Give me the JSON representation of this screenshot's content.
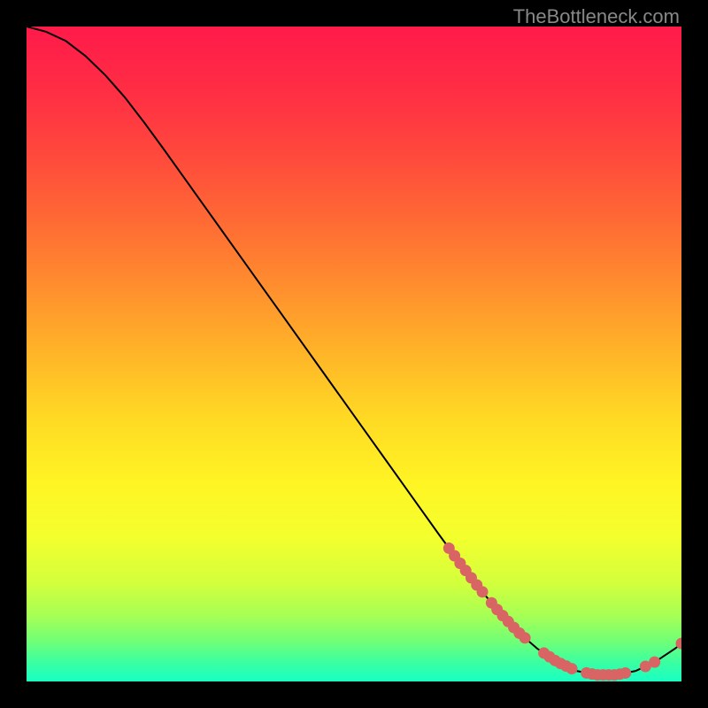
{
  "watermark": "TheBottleneck.com",
  "chart_data": {
    "type": "line",
    "title": "",
    "xlabel": "",
    "ylabel": "",
    "xlim": [
      0,
      100
    ],
    "ylim": [
      0,
      100
    ],
    "curve": [
      {
        "x": 0,
        "y": 100
      },
      {
        "x": 3,
        "y": 99.2
      },
      {
        "x": 6,
        "y": 97.8
      },
      {
        "x": 9,
        "y": 95.5
      },
      {
        "x": 12,
        "y": 92.6
      },
      {
        "x": 15,
        "y": 89.2
      },
      {
        "x": 18,
        "y": 85.3
      },
      {
        "x": 21,
        "y": 81.2
      },
      {
        "x": 24,
        "y": 77.0
      },
      {
        "x": 27,
        "y": 72.8
      },
      {
        "x": 30,
        "y": 68.6
      },
      {
        "x": 33,
        "y": 64.4
      },
      {
        "x": 36,
        "y": 60.2
      },
      {
        "x": 39,
        "y": 56.0
      },
      {
        "x": 42,
        "y": 51.8
      },
      {
        "x": 45,
        "y": 47.6
      },
      {
        "x": 48,
        "y": 43.4
      },
      {
        "x": 51,
        "y": 39.2
      },
      {
        "x": 54,
        "y": 35.0
      },
      {
        "x": 57,
        "y": 30.8
      },
      {
        "x": 60,
        "y": 26.6
      },
      {
        "x": 63,
        "y": 22.4
      },
      {
        "x": 66,
        "y": 18.3
      },
      {
        "x": 69,
        "y": 14.4
      },
      {
        "x": 72,
        "y": 10.8
      },
      {
        "x": 75,
        "y": 7.6
      },
      {
        "x": 78,
        "y": 5.0
      },
      {
        "x": 81,
        "y": 3.0
      },
      {
        "x": 84,
        "y": 1.6
      },
      {
        "x": 87,
        "y": 1.0
      },
      {
        "x": 90,
        "y": 1.0
      },
      {
        "x": 93,
        "y": 1.6
      },
      {
        "x": 96,
        "y": 3.0
      },
      {
        "x": 99,
        "y": 5.0
      },
      {
        "x": 100,
        "y": 5.8
      }
    ],
    "dot_clusters": [
      {
        "x_start": 64.5,
        "x_end": 70.0,
        "y_base": "curve",
        "dense": true
      },
      {
        "x_start": 71.0,
        "x_end": 76.5,
        "y_base": "curve",
        "dense": true
      },
      {
        "x_start": 79.0,
        "x_end": 84.0,
        "y_base": "curve",
        "dense": true
      },
      {
        "x_start": 85.5,
        "x_end": 91.5,
        "y_base": "curve",
        "dense": true
      },
      {
        "x_start": 94.5,
        "x_end": 96.0,
        "y_base": "curve",
        "dense": false
      }
    ],
    "end_dot": {
      "x": 100,
      "y": 5.8
    },
    "gradient_stops": [
      {
        "offset": 0.0,
        "color": "#ff1a4a"
      },
      {
        "offset": 0.1,
        "color": "#ff2e44"
      },
      {
        "offset": 0.2,
        "color": "#ff4a3c"
      },
      {
        "offset": 0.3,
        "color": "#ff6b34"
      },
      {
        "offset": 0.4,
        "color": "#ff8f2e"
      },
      {
        "offset": 0.5,
        "color": "#ffb528"
      },
      {
        "offset": 0.6,
        "color": "#ffda24"
      },
      {
        "offset": 0.7,
        "color": "#fff524"
      },
      {
        "offset": 0.78,
        "color": "#f4ff2e"
      },
      {
        "offset": 0.85,
        "color": "#d2ff3c"
      },
      {
        "offset": 0.9,
        "color": "#a6ff55"
      },
      {
        "offset": 0.94,
        "color": "#6eff78"
      },
      {
        "offset": 0.97,
        "color": "#3cffa0"
      },
      {
        "offset": 1.0,
        "color": "#18ffc4"
      }
    ],
    "dot_color": "#d86464",
    "line_color": "#000000"
  }
}
